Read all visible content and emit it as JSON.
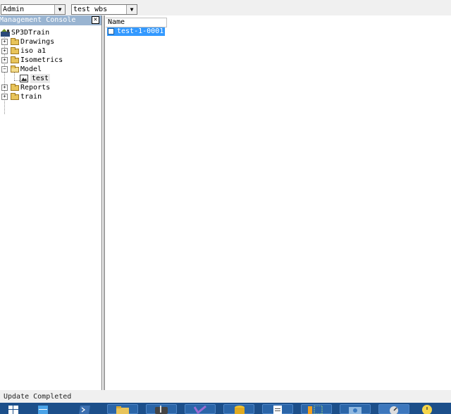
{
  "toolbar": {
    "user_combo": "Admin",
    "wbs_combo": "test wbs"
  },
  "left_pane": {
    "title": "Management Console",
    "close_glyph": "✕",
    "tree": {
      "root": "SP3DTrain",
      "items": [
        {
          "label": "Drawings"
        },
        {
          "label": "iso a1"
        },
        {
          "label": "Isometrics"
        },
        {
          "label": "Model",
          "children": [
            {
              "label": "test"
            }
          ]
        },
        {
          "label": "Reports"
        },
        {
          "label": "train"
        }
      ]
    }
  },
  "right_pane": {
    "column": "Name",
    "items": [
      {
        "label": "test-1-0001",
        "selected": true
      }
    ]
  },
  "status": {
    "text": "Update Completed"
  },
  "taskbar": {
    "icons": [
      "windows-start-icon",
      "server-manager-icon",
      "powershell-icon",
      "file-explorer-icon",
      "app-icon",
      "visual-studio-icon",
      "database-icon",
      "document-icon",
      "tool-icon",
      "network-icon",
      "gauge-icon",
      "clock-icon"
    ]
  },
  "colors": {
    "selection": "#3399ff",
    "pane_header": "#99b4d1",
    "taskbar": "#1c4f8a"
  }
}
